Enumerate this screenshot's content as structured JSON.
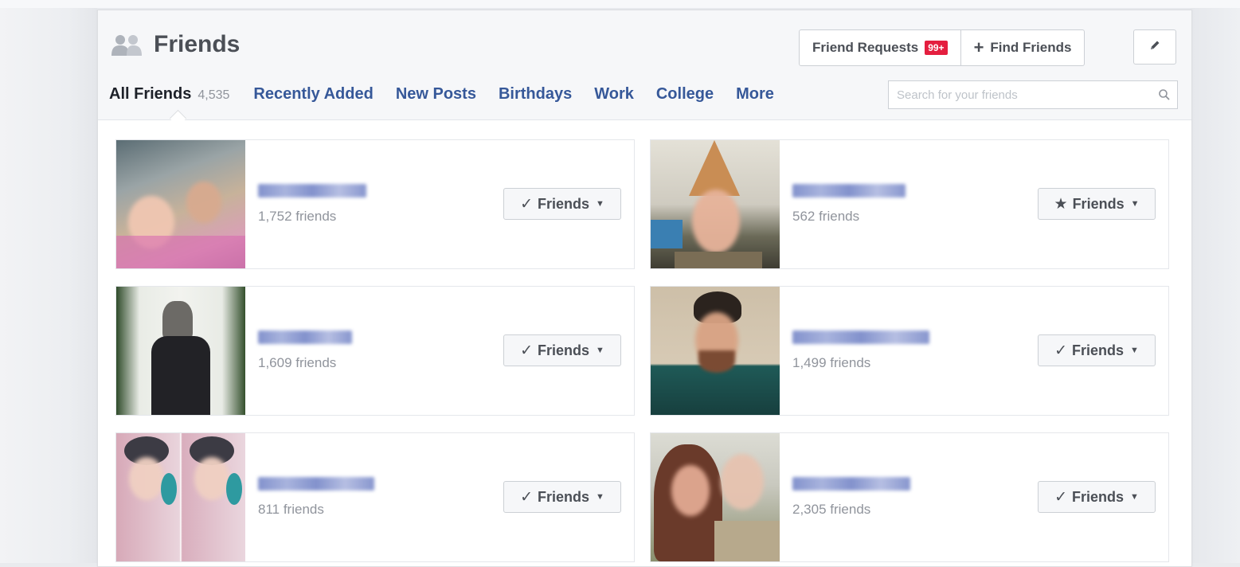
{
  "header": {
    "title": "Friends",
    "friend_requests_label": "Friend Requests",
    "friend_requests_badge": "99+",
    "find_friends_label": "Find Friends"
  },
  "tabs": {
    "all_friends": "All Friends",
    "all_friends_count": "4,535",
    "recently_added": "Recently Added",
    "new_posts": "New Posts",
    "birthdays": "Birthdays",
    "work": "Work",
    "college": "College",
    "more": "More"
  },
  "search": {
    "placeholder": "Search for your friends"
  },
  "friends": [
    {
      "friend_count": "1,752 friends",
      "button_label": "Friends",
      "button_icon": "check-icon"
    },
    {
      "friend_count": "562 friends",
      "button_label": "Friends",
      "button_icon": "star-icon"
    },
    {
      "friend_count": "1,609 friends",
      "button_label": "Friends",
      "button_icon": "check-icon"
    },
    {
      "friend_count": "1,499 friends",
      "button_label": "Friends",
      "button_icon": "check-icon"
    },
    {
      "friend_count": "811 friends",
      "button_label": "Friends",
      "button_icon": "check-icon"
    },
    {
      "friend_count": "2,305 friends",
      "button_label": "Friends",
      "button_icon": "check-icon"
    }
  ],
  "colors": {
    "link": "#365899",
    "badge": "#e41e3f",
    "header_bg": "#f6f7f9",
    "muted_text": "#90949c"
  }
}
